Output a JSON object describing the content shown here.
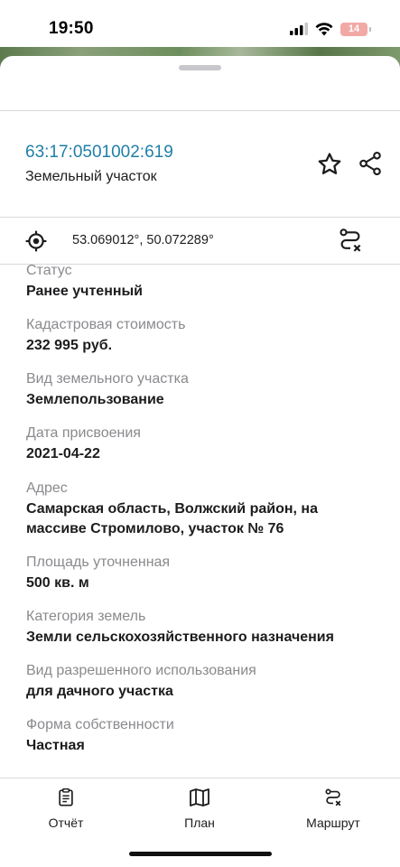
{
  "status_bar": {
    "time": "19:50",
    "battery": "14"
  },
  "parcel": {
    "cadastral_number": "63:17:0501002:619",
    "type": "Земельный участок",
    "coordinates": "53.069012°, 50.072289°"
  },
  "details": [
    {
      "label": "Статус",
      "value": "Ранее учтенный"
    },
    {
      "label": "Кадастровая стоимость",
      "value": "232 995 руб."
    },
    {
      "label": "Вид земельного участка",
      "value": "Землепользование"
    },
    {
      "label": "Дата присвоения",
      "value": "2021-04-22"
    },
    {
      "label": "Адрес",
      "value": "Самарская область, Волжский район, на массиве Стромилово, участок № 76"
    },
    {
      "label": "Площадь уточненная",
      "value": "500 кв. м"
    },
    {
      "label": "Категория земель",
      "value": "Земли сельскохозяйственного назначения"
    },
    {
      "label": "Вид разрешенного использования",
      "value": "для дачного участка"
    },
    {
      "label": "Форма собственности",
      "value": "Частная"
    }
  ],
  "tabbar": {
    "report": "Отчёт",
    "plan": "План",
    "route": "Маршрут"
  },
  "icons": {
    "favorite": "star-icon",
    "share": "share-icon",
    "locate": "crosshair-icon",
    "route": "route-icon",
    "report": "clipboard-icon",
    "plan": "map-icon"
  },
  "colors": {
    "accent_link": "#1f7fa8",
    "label_gray": "#8a8a8e",
    "battery_low": "#f1a9a6"
  }
}
